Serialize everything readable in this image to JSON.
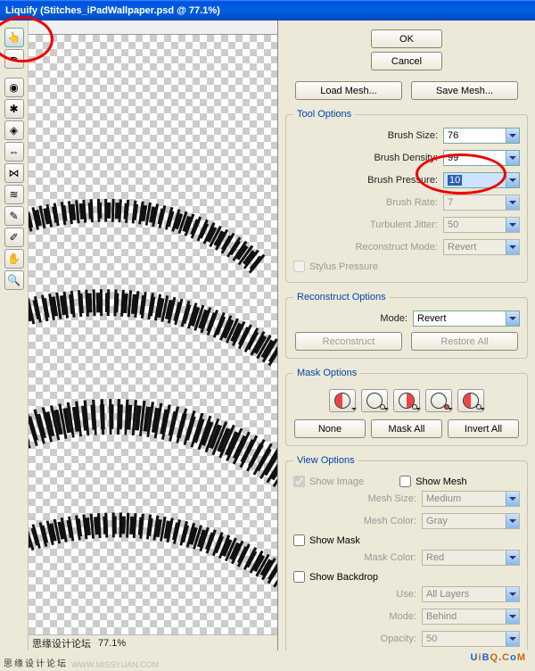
{
  "window": {
    "title": "Liquify (Stitches_iPadWallpaper.psd @ 77.1%)"
  },
  "tools": [
    {
      "name": "forward-warp",
      "glyph": "👆",
      "selected": true
    },
    {
      "name": "reconstruct",
      "glyph": "✒"
    },
    {
      "name": "twirl",
      "glyph": "◉"
    },
    {
      "name": "pucker",
      "glyph": "✱"
    },
    {
      "name": "bloat",
      "glyph": "◈"
    },
    {
      "name": "push-left",
      "glyph": "⇔"
    },
    {
      "name": "mirror",
      "glyph": "⋈"
    },
    {
      "name": "turbulence",
      "glyph": "≋"
    },
    {
      "name": "freeze-mask",
      "glyph": "✎"
    },
    {
      "name": "thaw-mask",
      "glyph": "✐"
    },
    {
      "name": "hand",
      "glyph": "✋"
    },
    {
      "name": "zoom",
      "glyph": "🔍"
    }
  ],
  "status": {
    "zoom": "77.1%",
    "site": "思缘设计论坛",
    "url": "WWW.MISSYUAN.COM"
  },
  "buttons": {
    "ok": "OK",
    "cancel": "Cancel",
    "load_mesh": "Load Mesh...",
    "save_mesh": "Save Mesh...",
    "reconstruct": "Reconstruct",
    "restore_all": "Restore All",
    "none": "None",
    "mask_all": "Mask All",
    "invert_all": "Invert All"
  },
  "sections": {
    "tool_options": "Tool Options",
    "reconstruct_options": "Reconstruct Options",
    "mask_options": "Mask Options",
    "view_options": "View Options"
  },
  "tool_options": {
    "brush_size": {
      "label": "Brush Size:",
      "value": "76"
    },
    "brush_density": {
      "label": "Brush Density:",
      "value": "99"
    },
    "brush_pressure": {
      "label": "Brush Pressure:",
      "value": "10",
      "selected": true
    },
    "brush_rate": {
      "label": "Brush Rate:",
      "value": "7",
      "disabled": true
    },
    "turbulent_jitter": {
      "label": "Turbulent Jitter:",
      "value": "50",
      "disabled": true
    },
    "reconstruct_mode": {
      "label": "Reconstruct Mode:",
      "value": "Revert",
      "disabled": true
    },
    "stylus": "Stylus Pressure"
  },
  "reconstruct": {
    "mode_label": "Mode:",
    "mode_value": "Revert"
  },
  "view": {
    "show_image": "Show Image",
    "show_mesh": "Show Mesh",
    "mesh_size": {
      "label": "Mesh Size:",
      "value": "Medium"
    },
    "mesh_color": {
      "label": "Mesh Color:",
      "value": "Gray"
    },
    "show_mask": "Show Mask",
    "mask_color": {
      "label": "Mask Color:",
      "value": "Red"
    },
    "show_backdrop": "Show Backdrop",
    "use": {
      "label": "Use:",
      "value": "All Layers"
    },
    "mode": {
      "label": "Mode:",
      "value": "Behind"
    },
    "opacity": {
      "label": "Opacity:",
      "value": "50"
    }
  },
  "watermark": "UiBQ.CoM"
}
